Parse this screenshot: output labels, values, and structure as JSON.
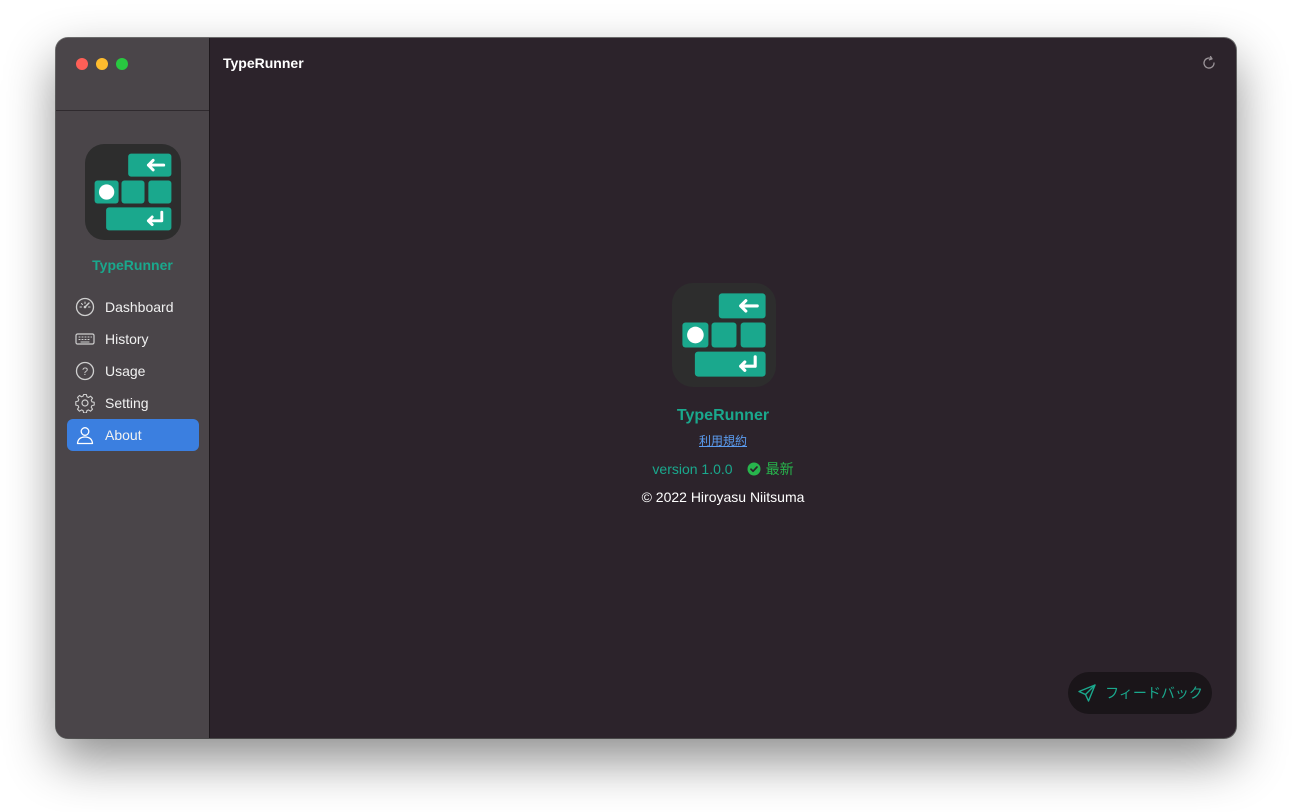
{
  "window": {
    "title": "TypeRunner"
  },
  "sidebar": {
    "app_name": "TypeRunner",
    "items": [
      {
        "label": "Dashboard",
        "icon": "gauge-icon",
        "active": false
      },
      {
        "label": "History",
        "icon": "keyboard-icon",
        "active": false
      },
      {
        "label": "Usage",
        "icon": "question-icon",
        "active": false
      },
      {
        "label": "Setting",
        "icon": "gear-icon",
        "active": false
      },
      {
        "label": "About",
        "icon": "person-icon",
        "active": true
      }
    ]
  },
  "about": {
    "app_name": "TypeRunner",
    "terms_link": "利用規約",
    "version": "version 1.0.0",
    "status": "最新",
    "copyright": "© 2022 Hiroyasu Niitsuma"
  },
  "feedback": {
    "label": "フィードバック",
    "icon": "send-icon"
  },
  "colors": {
    "accent": "#1aa88d",
    "selection": "#3b7fe0",
    "status_ok": "#27b44c",
    "link": "#5b9cf0"
  }
}
